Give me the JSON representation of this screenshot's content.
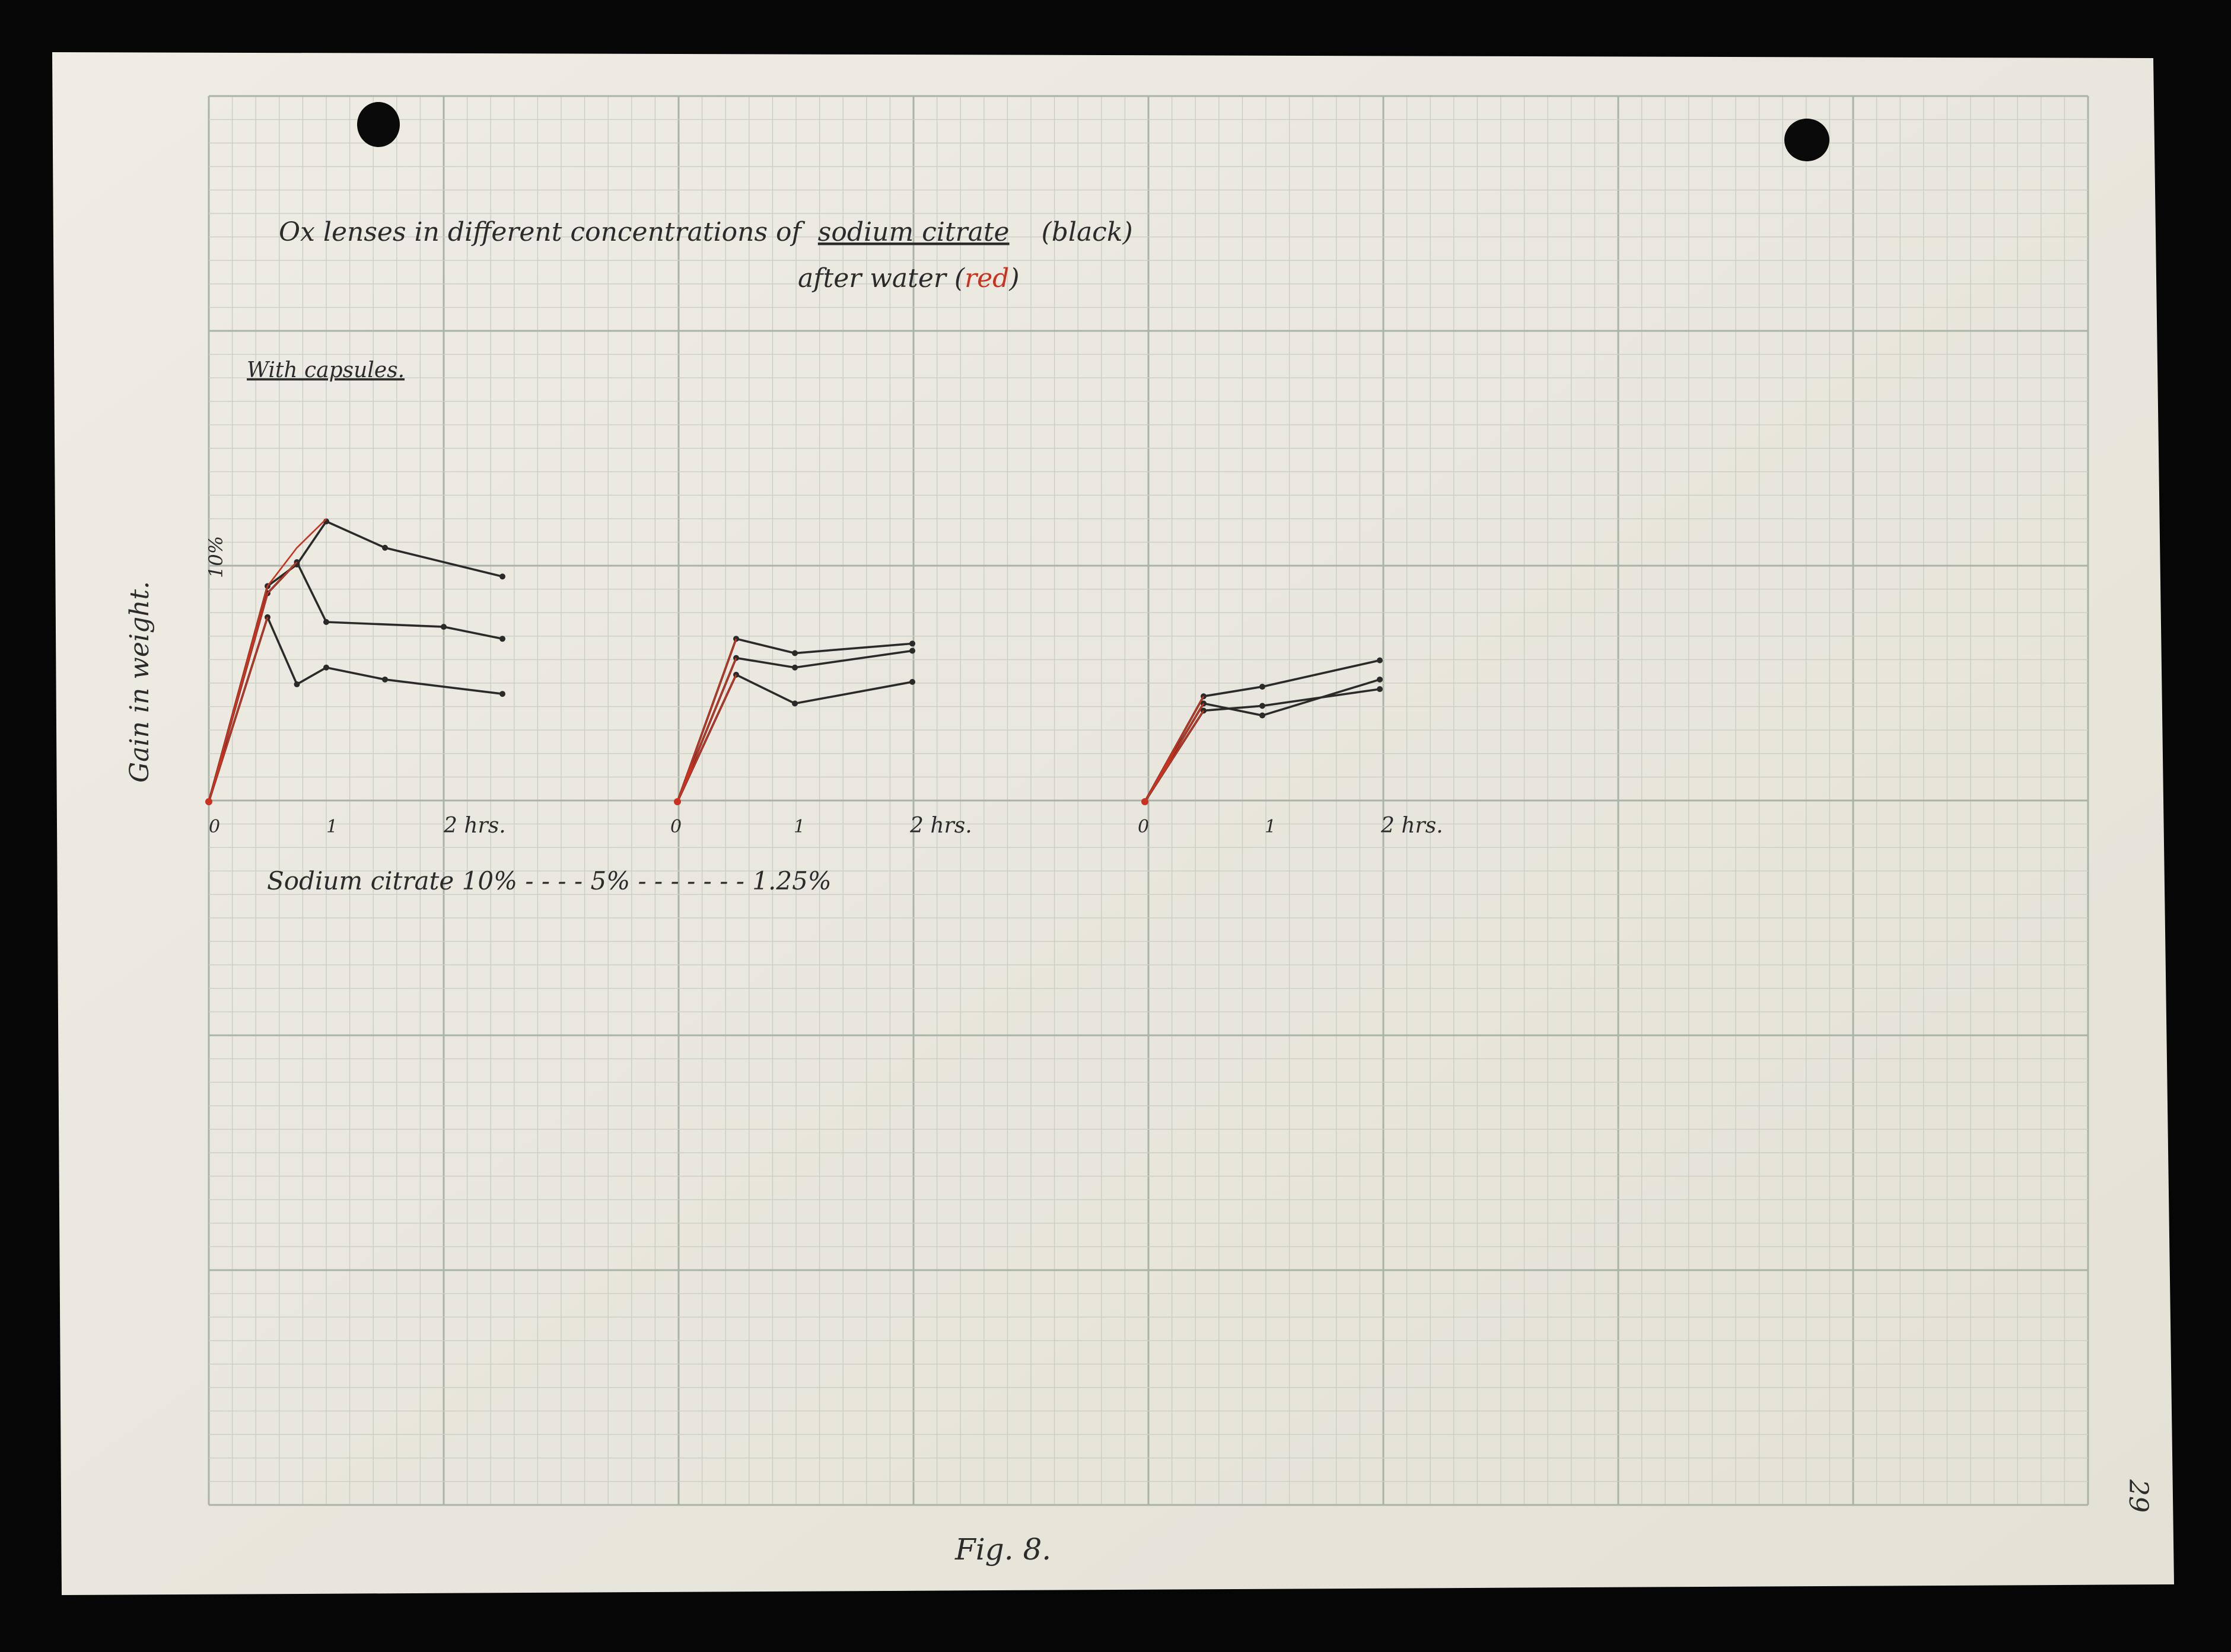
{
  "document": {
    "title_line1_prefix": "Ox lenses in different concentrations of",
    "title_line1_underlined": "sodium citrate",
    "title_line1_suffix": "(black)",
    "title_line2_prefix": "after  water  (",
    "title_line2_red": "red",
    "title_line2_suffix": ")",
    "subtitle": "With capsules.",
    "ylabel": "Gain in weight.",
    "ytick_10": "10%",
    "concentration_caption": "Sodium citrate 10% - - - - 5% - - - - - - - 1.25%",
    "figure_label": "Fig. 8.",
    "page_number": "29"
  },
  "colors": {
    "paper": "#ebe9e0",
    "grid_fine": "#c9cfc4",
    "grid_major": "#aab3a7",
    "black_ink": "#2a2a2a",
    "red_ink": "#c8321f"
  },
  "chart_data": [
    {
      "type": "line",
      "panel": "Sodium citrate 10%",
      "x_unit": "hrs",
      "xticks": [
        "0",
        "1",
        "2 hrs."
      ],
      "xlim": [
        0,
        2.6
      ],
      "ylim": [
        0,
        14
      ],
      "y_tick_label": "10%",
      "series": [
        {
          "color": "black",
          "x": [
            0,
            0.5,
            0.75,
            1,
            1.5,
            2.5
          ],
          "y": [
            0,
            9,
            9.9,
            11.7,
            10.6,
            9.4
          ]
        },
        {
          "color": "black",
          "x": [
            0,
            0.5,
            0.75,
            1,
            2,
            2.5
          ],
          "y": [
            0,
            8.7,
            10,
            7.5,
            7.3,
            6.8
          ]
        },
        {
          "color": "black",
          "x": [
            0,
            0.5,
            0.75,
            1,
            1.5,
            2.5
          ],
          "y": [
            0,
            7.7,
            4.9,
            5.6,
            5.1,
            4.5
          ]
        },
        {
          "color": "red",
          "x": [
            0,
            0.5,
            0.75,
            1
          ],
          "y": [
            0,
            9,
            10.6,
            11.8
          ]
        },
        {
          "color": "red",
          "x": [
            0,
            0.5,
            0.75
          ],
          "y": [
            0,
            8.7,
            10
          ]
        },
        {
          "color": "red",
          "x": [
            0,
            0.5
          ],
          "y": [
            0,
            7.7
          ]
        }
      ]
    },
    {
      "type": "line",
      "panel": "5%",
      "x_unit": "hrs",
      "xticks": [
        "0",
        "1",
        "2 hrs."
      ],
      "xlim": [
        0,
        2
      ],
      "ylim": [
        0,
        14
      ],
      "series": [
        {
          "color": "black",
          "x": [
            0,
            0.5,
            1,
            2
          ],
          "y": [
            0,
            6.8,
            6.2,
            6.6
          ]
        },
        {
          "color": "black",
          "x": [
            0,
            0.5,
            1,
            2
          ],
          "y": [
            0,
            6.0,
            5.6,
            6.3
          ]
        },
        {
          "color": "black",
          "x": [
            0,
            0.5,
            1,
            2
          ],
          "y": [
            0,
            5.3,
            4.1,
            5.0
          ]
        },
        {
          "color": "red",
          "x": [
            0,
            0.5
          ],
          "y": [
            0,
            6.8
          ]
        },
        {
          "color": "red",
          "x": [
            0,
            0.5
          ],
          "y": [
            0,
            6.0
          ]
        },
        {
          "color": "red",
          "x": [
            0,
            0.5
          ],
          "y": [
            0,
            5.3
          ]
        }
      ]
    },
    {
      "type": "line",
      "panel": "1.25%",
      "x_unit": "hrs",
      "xticks": [
        "0",
        "1",
        "2 hrs."
      ],
      "xlim": [
        0,
        2
      ],
      "ylim": [
        0,
        14
      ],
      "series": [
        {
          "color": "black",
          "x": [
            0,
            0.5,
            1,
            2
          ],
          "y": [
            0,
            4.4,
            4.8,
            5.9
          ]
        },
        {
          "color": "black",
          "x": [
            0,
            0.5,
            1,
            2
          ],
          "y": [
            0,
            4.1,
            3.6,
            5.1
          ]
        },
        {
          "color": "black",
          "x": [
            0,
            0.5,
            1,
            2
          ],
          "y": [
            0,
            3.8,
            4.0,
            4.7
          ]
        },
        {
          "color": "red",
          "x": [
            0,
            0.5
          ],
          "y": [
            0,
            4.4
          ]
        },
        {
          "color": "red",
          "x": [
            0,
            0.5
          ],
          "y": [
            0,
            4.1
          ]
        },
        {
          "color": "red",
          "x": [
            0,
            0.5
          ],
          "y": [
            0,
            3.8
          ]
        }
      ]
    }
  ]
}
